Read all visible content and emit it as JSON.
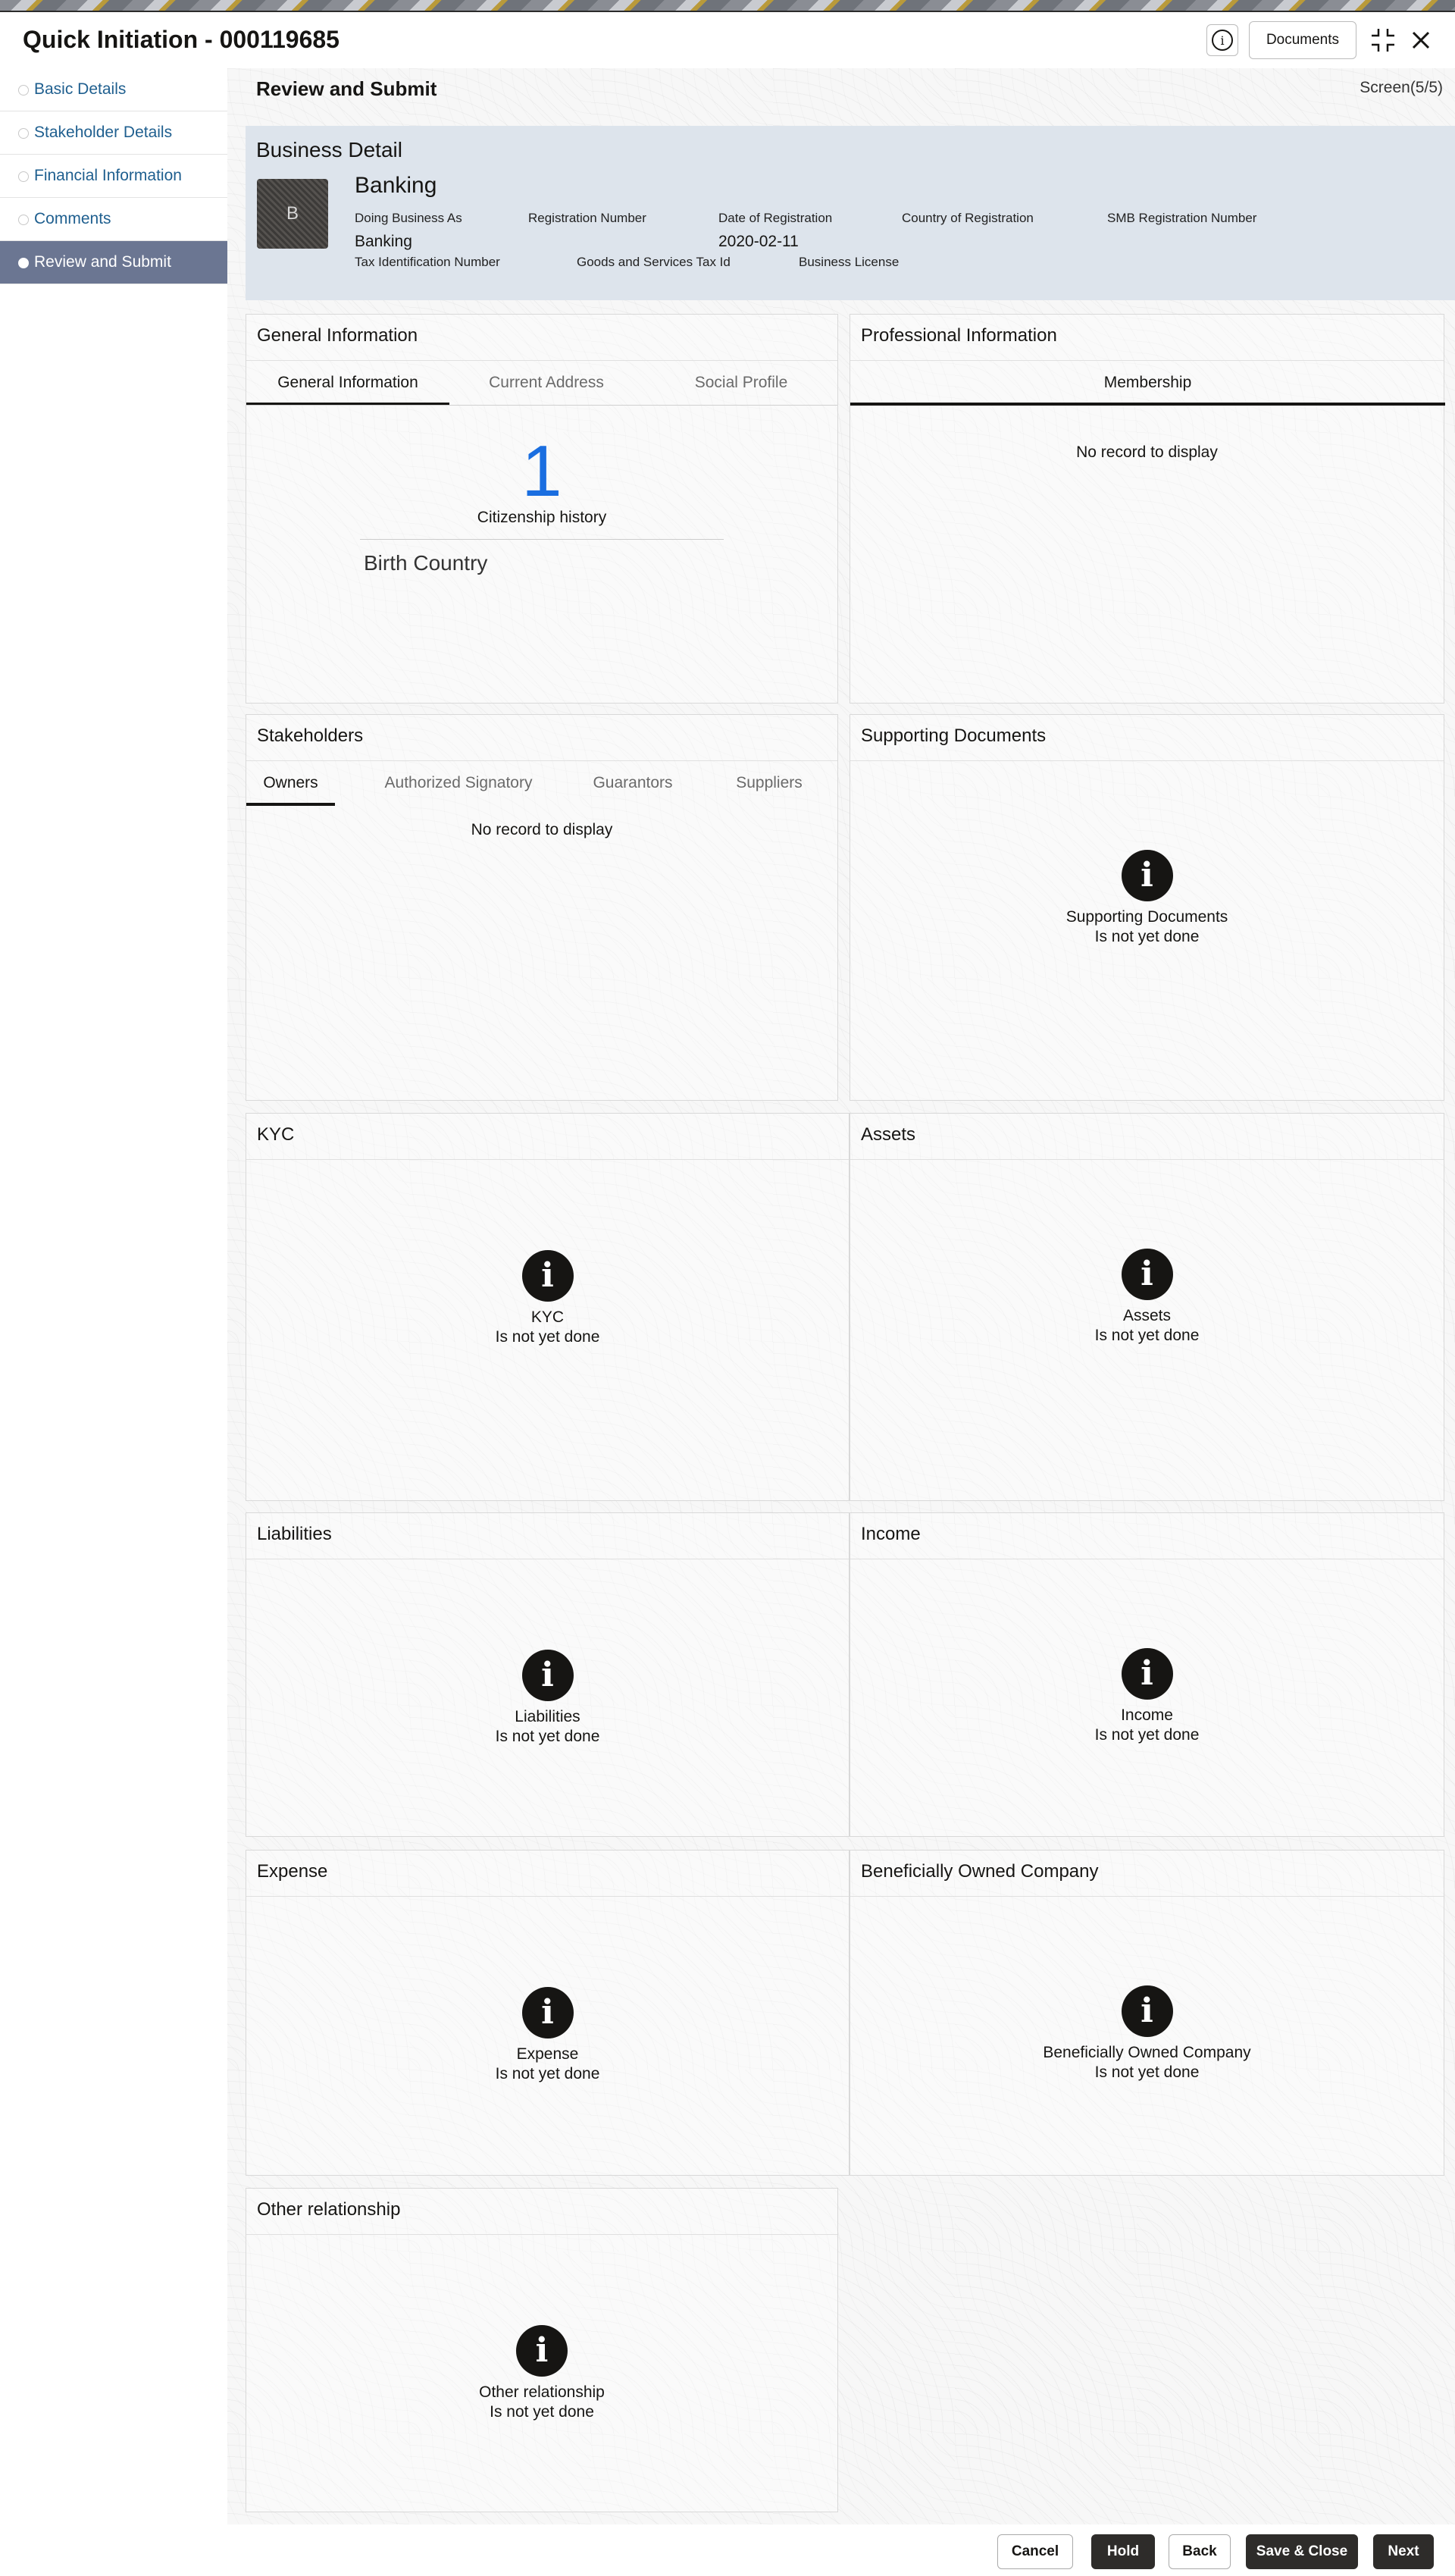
{
  "header": {
    "title": "Quick Initiation - 000119685",
    "documents_label": "Documents"
  },
  "sidebar": {
    "items": [
      {
        "label": "Basic Details"
      },
      {
        "label": "Stakeholder Details"
      },
      {
        "label": "Financial Information"
      },
      {
        "label": "Comments"
      },
      {
        "label": "Review and Submit",
        "active": true
      }
    ]
  },
  "page": {
    "title": "Review and Submit",
    "screen": "Screen(5/5)"
  },
  "business": {
    "heading": "Business Detail",
    "avatar_initial": "B",
    "name": "Banking",
    "labels": {
      "dba": "Doing Business As",
      "reg_no": "Registration Number",
      "reg_date": "Date of Registration",
      "country": "Country of Registration",
      "smb": "SMB Registration Number",
      "tin": "Tax Identification Number",
      "gst": "Goods and Services Tax Id",
      "license": "Business License"
    },
    "values": {
      "dba": "Banking",
      "reg_date": "2020-02-11"
    }
  },
  "general": {
    "title": "General Information",
    "tabs": [
      "General Information",
      "Current Address",
      "Social Profile"
    ],
    "count": "1",
    "count_label": "Citizenship history",
    "birth_label": "Birth Country"
  },
  "professional": {
    "title": "Professional Information",
    "tab": "Membership",
    "empty": "No record to display"
  },
  "stakeholders": {
    "title": "Stakeholders",
    "tabs": [
      "Owners",
      "Authorized Signatory",
      "Guarantors",
      "Suppliers"
    ],
    "empty": "No record to display"
  },
  "not_done_text": "Is not yet done",
  "sections": {
    "supporting": "Supporting Documents",
    "kyc": "KYC",
    "assets": "Assets",
    "liabilities": "Liabilities",
    "income": "Income",
    "expense": "Expense",
    "boc": "Beneficially Owned Company",
    "other": "Other relationship"
  },
  "footer": {
    "cancel": "Cancel",
    "hold": "Hold",
    "back": "Back",
    "save_close": "Save & Close",
    "next": "Next"
  },
  "colors": {
    "accent": "#6b7692",
    "link": "#1f5f8f",
    "count": "#1a6ee0",
    "dark_button": "#2e2c2a"
  }
}
